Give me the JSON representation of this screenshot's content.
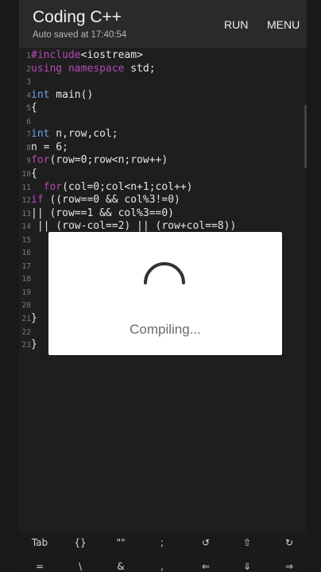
{
  "header": {
    "title": "Coding C++",
    "autosave": "Auto saved at 17:40:54",
    "run_label": "RUN",
    "menu_label": "MENU"
  },
  "editor": {
    "lines": [
      {
        "n": "1",
        "parts": [
          {
            "t": "#include",
            "c": "kw"
          },
          {
            "t": "<iostream>",
            "c": "plain"
          }
        ]
      },
      {
        "n": "2",
        "parts": [
          {
            "t": "using namespace",
            "c": "kw"
          },
          {
            "t": " std;",
            "c": "plain"
          }
        ]
      },
      {
        "n": "3",
        "parts": []
      },
      {
        "n": "4",
        "parts": [
          {
            "t": "int",
            "c": "type"
          },
          {
            "t": " main()",
            "c": "plain"
          }
        ]
      },
      {
        "n": "5",
        "parts": [
          {
            "t": "{",
            "c": "plain"
          }
        ]
      },
      {
        "n": "6",
        "parts": []
      },
      {
        "n": "7",
        "parts": [
          {
            "t": "int",
            "c": "type"
          },
          {
            "t": " n,row,col;",
            "c": "plain"
          }
        ]
      },
      {
        "n": "8",
        "parts": [
          {
            "t": "n = 6;",
            "c": "plain"
          }
        ]
      },
      {
        "n": "9",
        "parts": [
          {
            "t": "for",
            "c": "kw"
          },
          {
            "t": "(row=0;row<n;row++)",
            "c": "plain"
          }
        ]
      },
      {
        "n": "10",
        "parts": [
          {
            "t": "{",
            "c": "plain"
          }
        ]
      },
      {
        "n": "11",
        "parts": [
          {
            "t": "  for",
            "c": "kw"
          },
          {
            "t": "(col=0;col<n+1;col++)",
            "c": "plain"
          }
        ]
      },
      {
        "n": "12",
        "parts": [
          {
            "t": "if",
            "c": "kw"
          },
          {
            "t": " ((row==0 && col%3!=0)",
            "c": "plain"
          }
        ]
      },
      {
        "n": "13",
        "parts": [
          {
            "t": "|| (row==1 && col%3==0)",
            "c": "plain"
          }
        ]
      },
      {
        "n": "14",
        "parts": [
          {
            "t": " || (row-col==2) || (row+col==8))",
            "c": "plain"
          }
        ]
      },
      {
        "n": "15",
        "parts": []
      },
      {
        "n": "16",
        "parts": []
      },
      {
        "n": "17",
        "parts": []
      },
      {
        "n": "18",
        "parts": []
      },
      {
        "n": "19",
        "parts": []
      },
      {
        "n": "20",
        "parts": []
      },
      {
        "n": "21",
        "parts": [
          {
            "t": "}",
            "c": "plain"
          }
        ]
      },
      {
        "n": "22",
        "parts": []
      },
      {
        "n": "23",
        "parts": [
          {
            "t": "}",
            "c": "plain"
          }
        ]
      }
    ]
  },
  "dialog": {
    "message": "Compiling..."
  },
  "toolbar": {
    "keys": [
      {
        "label": "Tab",
        "icon": "tab-key"
      },
      {
        "label": "{}",
        "icon": "braces-key"
      },
      {
        "label": "\"\"",
        "icon": "quotes-key"
      },
      {
        "label": ";",
        "icon": "semicolon-key"
      },
      {
        "label": "↺",
        "icon": "undo-icon"
      },
      {
        "label": "⇧",
        "icon": "shift-icon"
      },
      {
        "label": "↻",
        "icon": "redo-icon"
      }
    ],
    "keys_row2": [
      {
        "label": "=",
        "icon": "equals-key"
      },
      {
        "label": "\\",
        "icon": "backslash-key"
      },
      {
        "label": "&",
        "icon": "ampersand-key"
      },
      {
        "label": ",",
        "icon": "comma-key"
      },
      {
        "label": "⇐",
        "icon": "left-arrow-icon"
      },
      {
        "label": "⇓",
        "icon": "down-arrow-icon"
      },
      {
        "label": "⇒",
        "icon": "right-arrow-icon"
      }
    ]
  },
  "colors": {
    "keyword": "#b44ab4",
    "type": "#6f9fe8",
    "background": "#1e1e1e",
    "header": "#2a2a2a"
  }
}
